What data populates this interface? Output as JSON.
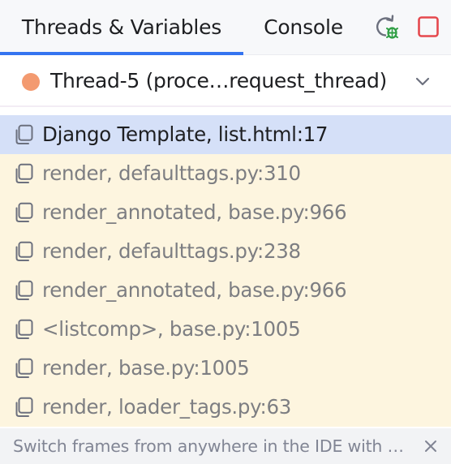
{
  "tabs": {
    "threads_label": "Threads & Variables",
    "console_label": "Console",
    "active": "Threads & Variables"
  },
  "toolbar": {
    "rerun_icon": "rerun-debug-icon",
    "stop_icon": "stop-icon"
  },
  "thread_selector": {
    "label": "Thread-5 (proce…request_thread)",
    "status_color": "#f39a70"
  },
  "frames": [
    {
      "label": "Django Template, list.html:17",
      "selected": true
    },
    {
      "label": "render, defaulttags.py:310",
      "selected": false
    },
    {
      "label": "render_annotated, base.py:966",
      "selected": false
    },
    {
      "label": "render, defaulttags.py:238",
      "selected": false
    },
    {
      "label": "render_annotated, base.py:966",
      "selected": false
    },
    {
      "label": "<listcomp>, base.py:1005",
      "selected": false
    },
    {
      "label": "render, base.py:1005",
      "selected": false
    },
    {
      "label": "render, loader_tags.py:63",
      "selected": false
    }
  ],
  "hint": {
    "text": "Switch frames from anywhere in the IDE with …"
  },
  "colors": {
    "accent": "#3574f0",
    "selected_row": "#d5e0f8",
    "library_frame_row": "#fdf5df",
    "stop_red": "#e5484d",
    "rerun_green": "#2f9e44"
  }
}
